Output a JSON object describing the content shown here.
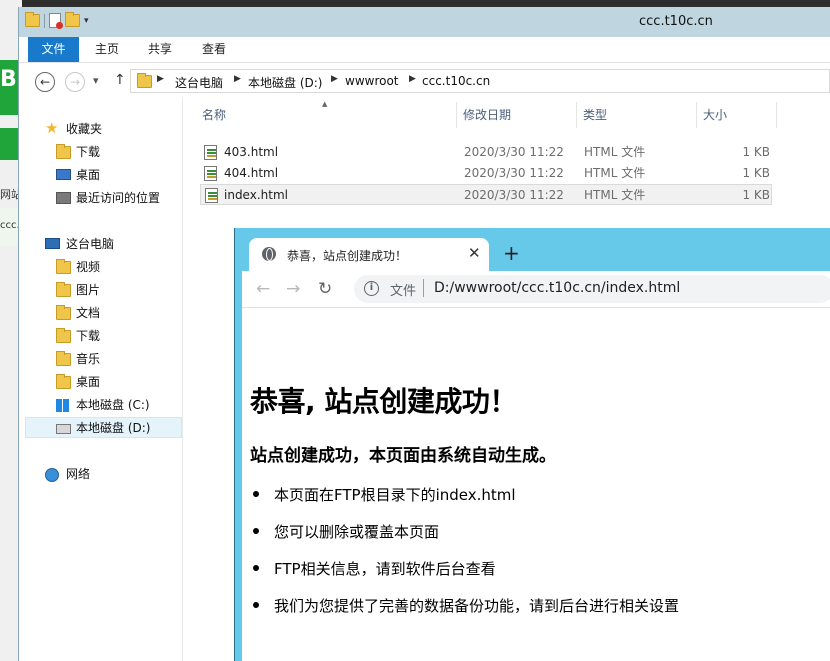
{
  "background_app": {
    "fragment_1": "B",
    "fragment_2": "网站",
    "fragment_3": "ccc."
  },
  "explorer": {
    "title": "ccc.t10c.cn",
    "ribbon_tabs": [
      "文件",
      "主页",
      "共享",
      "查看"
    ],
    "address_crumbs": [
      "这台电脑",
      "本地磁盘 (D:)",
      "wwwroot",
      "ccc.t10c.cn"
    ],
    "nav": {
      "favorites": "收藏夹",
      "fav_items": [
        "下载",
        "桌面",
        "最近访问的位置"
      ],
      "this_pc": "这台电脑",
      "pc_items": [
        "视频",
        "图片",
        "文档",
        "下载",
        "音乐",
        "桌面",
        "本地磁盘 (C:)",
        "本地磁盘 (D:)"
      ],
      "network": "网络"
    },
    "columns": [
      "名称",
      "修改日期",
      "类型",
      "大小"
    ],
    "files": [
      {
        "name": "403.html",
        "date": "2020/3/30 11:22",
        "type": "HTML 文件",
        "size": "1 KB"
      },
      {
        "name": "404.html",
        "date": "2020/3/30 11:22",
        "type": "HTML 文件",
        "size": "1 KB"
      },
      {
        "name": "index.html",
        "date": "2020/3/30 11:22",
        "type": "HTML 文件",
        "size": "1 KB"
      }
    ]
  },
  "browser": {
    "tab_title": "恭喜，站点创建成功！",
    "scheme_label": "文件",
    "url": "D:/wwwroot/ccc.t10c.cn/index.html",
    "page": {
      "heading": "恭喜, 站点创建成功！",
      "subheading": "站点创建成功，本页面由系统自动生成。",
      "items": [
        "本页面在FTP根目录下的index.html",
        "您可以删除或覆盖本页面",
        "FTP相关信息，请到软件后台查看",
        "我们为您提供了完善的数据备份功能，请到后台进行相关设置"
      ]
    }
  },
  "colors": {
    "file_tab": "#1979ca",
    "titlebar": "#bfd6e0",
    "browser_frame": "#66c9ea",
    "bg_green": "#20a53a"
  },
  "icons": [
    "folder-icon",
    "star-icon",
    "computer-icon",
    "drive-icon",
    "network-icon",
    "html-file-icon",
    "globe-icon",
    "info-icon"
  ]
}
